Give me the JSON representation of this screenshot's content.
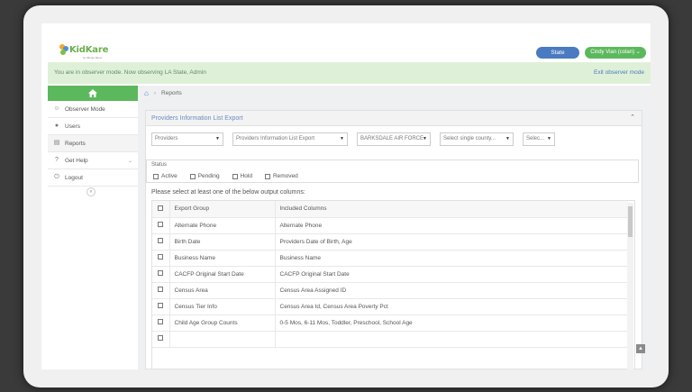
{
  "header": {
    "logo_text": "KidKare",
    "logo_sub": "by Minute Menu",
    "state_button": "State",
    "user_button": "Cindy Vian (colan)"
  },
  "observer": {
    "message": "You are in observer mode. Now observing LA State, Admin",
    "exit_label": "Exit observer mode"
  },
  "sidebar": {
    "items": [
      {
        "label": "Observer Mode",
        "icon": "users-icon"
      },
      {
        "label": "Users",
        "icon": "user-icon"
      },
      {
        "label": "Reports",
        "icon": "document-icon"
      },
      {
        "label": "Get Help",
        "icon": "help-icon"
      },
      {
        "label": "Logout",
        "icon": "power-icon"
      }
    ],
    "collapse_glyph": "«"
  },
  "breadcrumb": {
    "current": "Reports"
  },
  "panel": {
    "title": "Providers Information List Export",
    "filters": [
      "Providers",
      "Providers Information List Export",
      "BARKSDALE AIR FORCE",
      "Select single county...",
      "Selec..."
    ],
    "status_label": "Status",
    "status_options": [
      "Active",
      "Pending",
      "Hold",
      "Removed"
    ],
    "instruction": "Please select at least one of the below output columns:",
    "table": {
      "headers": [
        "Export Group",
        "Included Columns"
      ],
      "rows": [
        [
          "Alternate Phone",
          "Alternate Phone"
        ],
        [
          "Birth Date",
          "Providers Date of Birth, Age"
        ],
        [
          "Business Name",
          "Business Name"
        ],
        [
          "CACFP Original Start Date",
          "CACFP Original Start Date"
        ],
        [
          "Census Area",
          "Census Area Assigned ID"
        ],
        [
          "Census Tier Info",
          "Census Area Id, Census Area Poverty Pct"
        ],
        [
          "Child Age Group Counts",
          "0-5 Mos, 6-11 Mos, Toddler, Preschool, School Age"
        ],
        [
          "",
          ""
        ]
      ]
    }
  },
  "colors": {
    "green": "#5cb85c",
    "blue": "#4a7ac0",
    "observer_bg": "#dff0d8"
  }
}
